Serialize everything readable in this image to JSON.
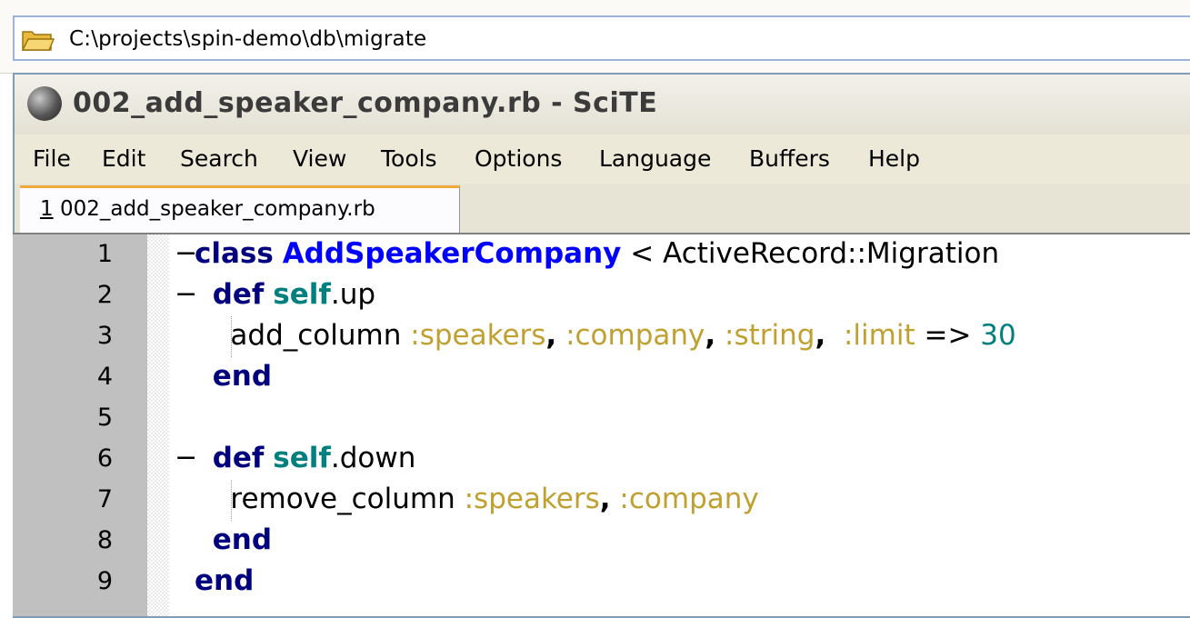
{
  "address_bar": {
    "path": "C:\\projects\\spin-demo\\db\\migrate",
    "icon": "folder-open-icon"
  },
  "window": {
    "title": "002_add_speaker_company.rb - SciTE",
    "icon": "scite-app-icon",
    "menu": [
      "File",
      "Edit",
      "Search",
      "View",
      "Tools",
      "Options",
      "Language",
      "Buffers",
      "Help"
    ],
    "tab": {
      "accel": "1",
      "label": " 002_add_speaker_company.rb"
    }
  },
  "editor": {
    "lines": [
      {
        "num": "1",
        "fold": "−",
        "tokens": [
          [
            "kw",
            "class"
          ],
          [
            "plain",
            " "
          ],
          [
            "cls",
            "AddSpeakerCompany"
          ],
          [
            "plain",
            " < ActiveRecord::Migration"
          ]
        ]
      },
      {
        "num": "2",
        "fold": "−",
        "tokens": [
          [
            "plain",
            "  "
          ],
          [
            "kw",
            "def"
          ],
          [
            "plain",
            " "
          ],
          [
            "slf",
            "self"
          ],
          [
            "plain",
            ".up"
          ]
        ]
      },
      {
        "num": "3",
        "fold": "",
        "tokens": [
          [
            "plain",
            "    add_column "
          ],
          [
            "sym",
            ":speakers"
          ],
          [
            "op",
            ","
          ],
          [
            "plain",
            " "
          ],
          [
            "sym",
            ":company"
          ],
          [
            "op",
            ","
          ],
          [
            "plain",
            " "
          ],
          [
            "sym",
            ":string"
          ],
          [
            "op",
            ","
          ],
          [
            "plain",
            "  "
          ],
          [
            "sym",
            ":limit"
          ],
          [
            "plain",
            " => "
          ],
          [
            "num",
            "30"
          ]
        ]
      },
      {
        "num": "4",
        "fold": "",
        "tokens": [
          [
            "plain",
            "  "
          ],
          [
            "kw",
            "end"
          ]
        ]
      },
      {
        "num": "5",
        "fold": "",
        "tokens": []
      },
      {
        "num": "6",
        "fold": "−",
        "tokens": [
          [
            "plain",
            "  "
          ],
          [
            "kw",
            "def"
          ],
          [
            "plain",
            " "
          ],
          [
            "slf",
            "self"
          ],
          [
            "plain",
            ".down"
          ]
        ]
      },
      {
        "num": "7",
        "fold": "",
        "tokens": [
          [
            "plain",
            "    remove_column "
          ],
          [
            "sym",
            ":speakers"
          ],
          [
            "op",
            ","
          ],
          [
            "plain",
            " "
          ],
          [
            "sym",
            ":company"
          ]
        ]
      },
      {
        "num": "8",
        "fold": "",
        "tokens": [
          [
            "plain",
            "  "
          ],
          [
            "kw",
            "end"
          ]
        ]
      },
      {
        "num": "9",
        "fold": "",
        "tokens": [
          [
            "kw",
            "end"
          ]
        ]
      }
    ]
  }
}
